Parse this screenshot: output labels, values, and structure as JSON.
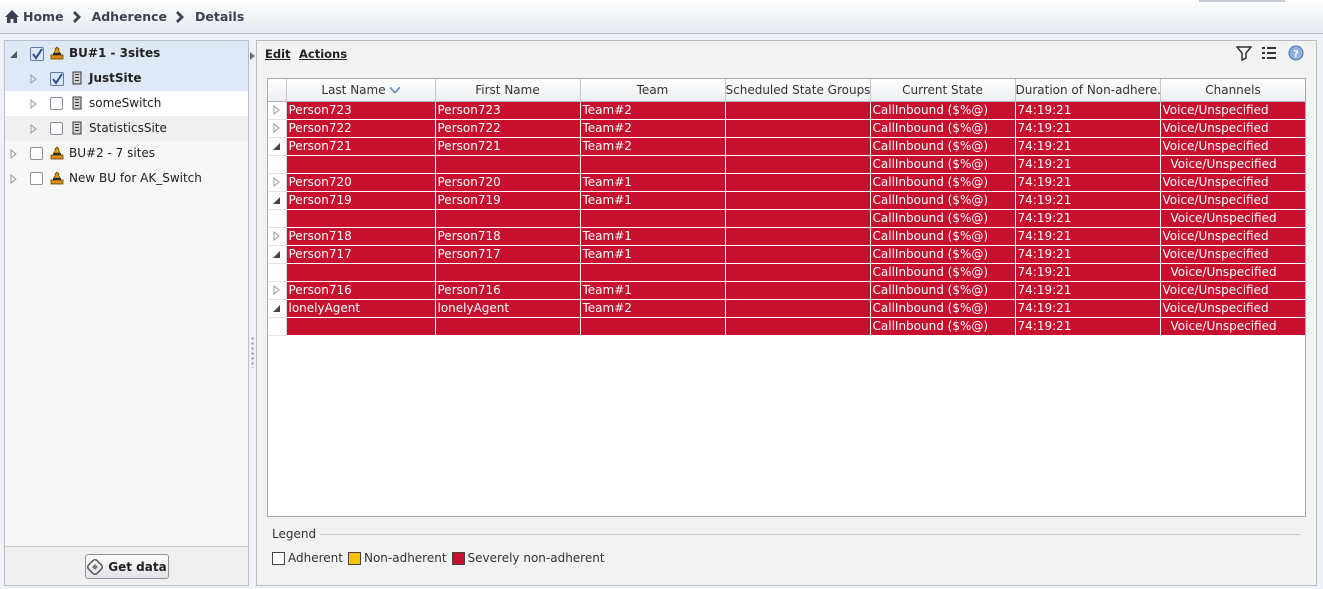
{
  "breadcrumb": {
    "home": "Home",
    "adherence": "Adherence",
    "details": "Details"
  },
  "tree": {
    "items": [
      {
        "label": "BU#1 - 3sites",
        "checked": true,
        "expanded": true,
        "type": "bu",
        "bold": true
      },
      {
        "label": "JustSite",
        "checked": true,
        "expanded": false,
        "type": "site",
        "bold": true
      },
      {
        "label": "someSwitch",
        "checked": false,
        "expanded": false,
        "type": "site",
        "bold": false
      },
      {
        "label": "StatisticsSite",
        "checked": false,
        "expanded": false,
        "type": "site",
        "bold": false
      },
      {
        "label": "BU#2 - 7 sites",
        "checked": false,
        "expanded": false,
        "type": "bu",
        "bold": false
      },
      {
        "label": "New BU for AK_Switch",
        "checked": false,
        "expanded": false,
        "type": "bu",
        "bold": false
      }
    ],
    "get_data_label": "Get data"
  },
  "toolbar": {
    "edit": "Edit",
    "actions": "Actions"
  },
  "grid": {
    "columns": [
      "Last Name",
      "First Name",
      "Team",
      "Scheduled State Groups",
      "Current State",
      "Duration of Non-adhere...",
      "Channels"
    ],
    "sorted_column": "Last Name",
    "rows": [
      {
        "expander": "collapsed",
        "last": "Person723",
        "first": "Person723",
        "team": "Team#2",
        "ssg": "",
        "state": "CallInbound ($%@)",
        "duration": "74:19:21",
        "channels": "Voice/Unspecified",
        "child": false
      },
      {
        "expander": "collapsed",
        "last": "Person722",
        "first": "Person722",
        "team": "Team#2",
        "ssg": "",
        "state": "CallInbound ($%@)",
        "duration": "74:19:21",
        "channels": "Voice/Unspecified",
        "child": false
      },
      {
        "expander": "expanded",
        "last": "Person721",
        "first": "Person721",
        "team": "Team#2",
        "ssg": "",
        "state": "CallInbound ($%@)",
        "duration": "74:19:21",
        "channels": "Voice/Unspecified",
        "child": false
      },
      {
        "expander": "none",
        "last": "",
        "first": "",
        "team": "",
        "ssg": "",
        "state": "CallInbound ($%@)",
        "duration": "74:19:21",
        "channels": "Voice/Unspecified",
        "child": true
      },
      {
        "expander": "collapsed",
        "last": "Person720",
        "first": "Person720",
        "team": "Team#1",
        "ssg": "",
        "state": "CallInbound ($%@)",
        "duration": "74:19:21",
        "channels": "Voice/Unspecified",
        "child": false
      },
      {
        "expander": "expanded",
        "last": "Person719",
        "first": "Person719",
        "team": "Team#1",
        "ssg": "",
        "state": "CallInbound ($%@)",
        "duration": "74:19:21",
        "channels": "Voice/Unspecified",
        "child": false
      },
      {
        "expander": "none",
        "last": "",
        "first": "",
        "team": "",
        "ssg": "",
        "state": "CallInbound ($%@)",
        "duration": "74:19:21",
        "channels": "Voice/Unspecified",
        "child": true
      },
      {
        "expander": "collapsed",
        "last": "Person718",
        "first": "Person718",
        "team": "Team#1",
        "ssg": "",
        "state": "CallInbound ($%@)",
        "duration": "74:19:21",
        "channels": "Voice/Unspecified",
        "child": false
      },
      {
        "expander": "expanded",
        "last": "Person717",
        "first": "Person717",
        "team": "Team#1",
        "ssg": "",
        "state": "CallInbound ($%@)",
        "duration": "74:19:21",
        "channels": "Voice/Unspecified",
        "child": false
      },
      {
        "expander": "none",
        "last": "",
        "first": "",
        "team": "",
        "ssg": "",
        "state": "CallInbound ($%@)",
        "duration": "74:19:21",
        "channels": "Voice/Unspecified",
        "child": true
      },
      {
        "expander": "collapsed",
        "last": "Person716",
        "first": "Person716",
        "team": "Team#1",
        "ssg": "",
        "state": "CallInbound ($%@)",
        "duration": "74:19:21",
        "channels": "Voice/Unspecified",
        "child": false
      },
      {
        "expander": "expanded",
        "last": "lonelyAgent",
        "first": "lonelyAgent",
        "team": "Team#2",
        "ssg": "",
        "state": "CallInbound ($%@)",
        "duration": "74:19:21",
        "channels": "Voice/Unspecified",
        "child": false
      },
      {
        "expander": "none",
        "last": "",
        "first": "",
        "team": "",
        "ssg": "",
        "state": "CallInbound ($%@)",
        "duration": "74:19:21",
        "channels": "Voice/Unspecified",
        "child": true
      }
    ]
  },
  "legend": {
    "title": "Legend",
    "items": [
      {
        "label": "Adherent",
        "color": "#ffffff"
      },
      {
        "label": "Non-adherent",
        "color": "#f5c400"
      },
      {
        "label": "Severely non-adherent",
        "color": "#c8102e"
      }
    ]
  },
  "colors": {
    "severe_row": "#c8102e",
    "selection": "#dfe8f7",
    "accent": "#3a5f9a"
  },
  "icons": [
    "home-icon",
    "chevron-right-icon",
    "bu-icon",
    "site-icon",
    "filter-icon",
    "list-icon",
    "help-icon",
    "get-data-icon",
    "sort-desc-icon"
  ]
}
